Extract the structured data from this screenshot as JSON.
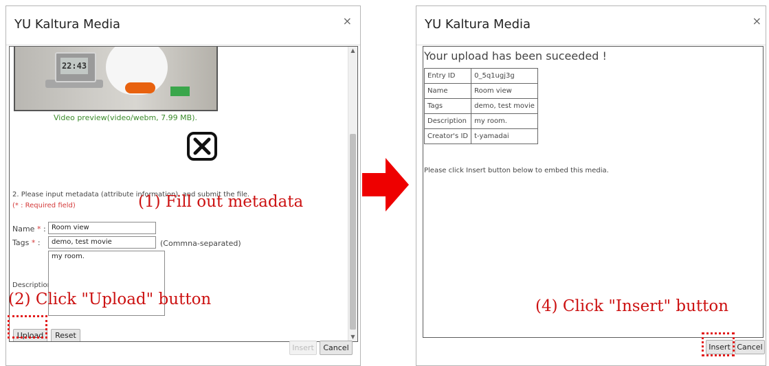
{
  "left_dialog": {
    "title": "YU Kaltura Media",
    "close": "×",
    "preview": {
      "clock_display": "22:43",
      "caption": "Video preview(video/webm, 7.99 MB)."
    },
    "remove_icon": "close-square-icon",
    "instruction": "2. Please input metadata (attribute information), and submit the file.",
    "required_note": "(* : Required field)",
    "fields": {
      "name_label": "Name",
      "name_value": "Room view",
      "tags_label": "Tags",
      "tags_value": "demo, test movie",
      "tags_hint": "(Commna-separated)",
      "description_label": "Description:",
      "description_value": "my room."
    },
    "required_marker": "*",
    "colon": " :",
    "buttons": {
      "upload": "Upload",
      "reset": "Reset",
      "insert": "Insert",
      "cancel": "Cancel"
    }
  },
  "right_dialog": {
    "title": "YU Kaltura Media",
    "close": "×",
    "success_message": "Your upload has been suceeded !",
    "info_rows": [
      {
        "key": "Entry ID",
        "value": "0_5q1ugj3g"
      },
      {
        "key": "Name",
        "value": "Room view"
      },
      {
        "key": "Tags",
        "value": "demo, test movie"
      },
      {
        "key": "Description",
        "value": "my room."
      },
      {
        "key": "Creator's ID",
        "value": "t-yamadai"
      }
    ],
    "embed_note": "Please click Insert button below to embed this media.",
    "buttons": {
      "insert": "Insert",
      "cancel": "Cancel"
    }
  },
  "annotations": {
    "step1": "(1) Fill out metadata",
    "step2": "(2) Click \"Upload\" button",
    "step4": "(4) Click \"Insert\" button"
  },
  "colors": {
    "annotation_red": "#cc1111",
    "arrow_red": "#ee0000",
    "caption_green": "#3a8a2a",
    "required_red": "#d43a3a"
  }
}
